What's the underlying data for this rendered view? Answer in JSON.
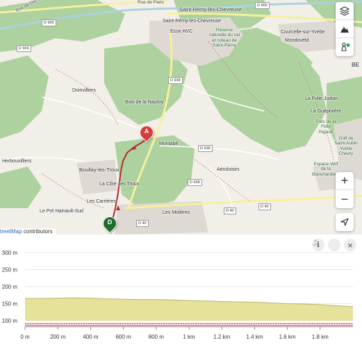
{
  "map": {
    "places": {
      "saint_remy": "Saint-Rémy-lès-Chevreuse",
      "saint_remy_2": "Saint-Rémy-lès-Chevreuse",
      "ecox": "Ecox HVC",
      "reserve": "Réserve naturelle du val et coteau de Saint-Rémy",
      "courcelle": "Courcelle-sur-Yvette",
      "mondoveld": "Mondoveld",
      "doinvilliers": "Doinvilliers",
      "bois_nauroy": "Bois de la Nauroy",
      "montabe": "Montabé",
      "herbouvilliers": "Herbouvilliers",
      "boullay": "Boullay-les-Troux",
      "la_cote": "La Côte des Troux",
      "les_carrieres": "Les Carrières",
      "pre_hainault": "Le Pré Hainault-Sud",
      "les_molieres": "Les Molières",
      "aeroloisirs": "Aéroloisirs",
      "folie_jodoin": "La Folie Jodoin",
      "guepiniere": "La Guépinière",
      "parc_folie": "Parc de la Folie Rigault",
      "golf": "Golf de Saint-Aubin Yvette Chevry",
      "espace_vert": "Espace Vert de la Blanchardière",
      "rue_dampierre": "Rue de Dampierre",
      "rue_paris": "Rue de Paris",
      "be": "BE"
    },
    "roads": {
      "d906a": "D 906",
      "d906b": "D 906",
      "d906c": "D 906",
      "d938a": "D 938",
      "d938b": "D 938",
      "d938c": "D 938",
      "d40a": "D 40",
      "d40b": "D 40",
      "d40c": "D 40"
    },
    "markers": {
      "start": "A",
      "end": "D"
    },
    "controls": {
      "layers": "layers-icon",
      "terrain": "mountain-icon",
      "poi": "hiker-icon",
      "zoom_in": "+",
      "zoom_out": "−",
      "locate": "navigation-arrow-icon"
    },
    "attribution": {
      "link": "treetMap",
      "rest": " contributors"
    }
  },
  "elevation": {
    "buttons": {
      "info": "i",
      "profile": "person-icon",
      "close": "×"
    },
    "chart_data": {
      "type": "area",
      "x": [
        0,
        0.1,
        0.2,
        0.3,
        0.4,
        0.5,
        0.6,
        0.7,
        0.8,
        0.9,
        1.0,
        1.1,
        1.2,
        1.3,
        1.4,
        1.5,
        1.6,
        1.7,
        1.8,
        1.9,
        2.0
      ],
      "y": [
        165,
        165,
        166,
        167,
        166,
        164,
        163,
        162,
        162,
        161,
        159,
        158,
        156,
        155,
        154,
        152,
        150,
        149,
        147,
        144,
        141
      ],
      "xlim": [
        0,
        2.0
      ],
      "ylim": [
        100,
        300
      ],
      "x_ticks": [
        "0 m",
        "200 m",
        "400 m",
        "600 m",
        "800 m",
        "1 km",
        "1.2 km",
        "1.4 km",
        "1.6 km",
        "1.8 km"
      ],
      "y_ticks": [
        "100 m",
        "150 m",
        "200 m",
        "250 m",
        "300 m"
      ],
      "fill_color": "#e6e29a",
      "line_color": "#b8b36a",
      "grid": true
    }
  }
}
